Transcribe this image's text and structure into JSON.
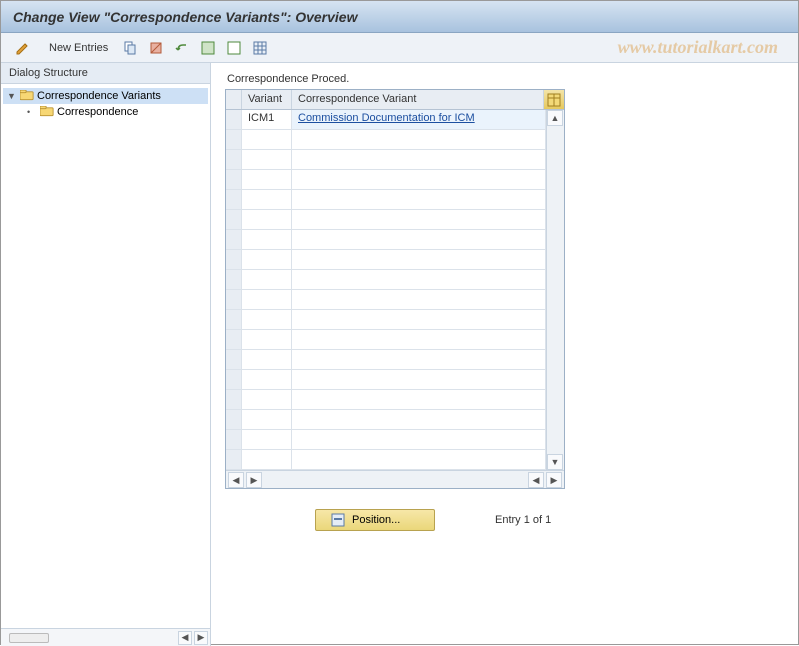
{
  "title": "Change View \"Correspondence Variants\": Overview",
  "toolbar": {
    "new_entries_label": "New Entries"
  },
  "watermark": "www.tutorialkart.com",
  "sidebar": {
    "title": "Dialog Structure",
    "items": [
      {
        "label": "Correspondence Variants",
        "selected": true,
        "expanded": true
      },
      {
        "label": "Correspondence",
        "selected": false
      }
    ]
  },
  "panel": {
    "title": "Correspondence Proced.",
    "columns": {
      "variant": "Variant",
      "desc": "Correspondence Variant"
    },
    "rows": [
      {
        "variant": "ICM1",
        "desc": "Commission Documentation for ICM"
      }
    ],
    "empty_row_count": 17
  },
  "footer": {
    "position_label": "Position...",
    "entry_text": "Entry 1 of 1"
  }
}
